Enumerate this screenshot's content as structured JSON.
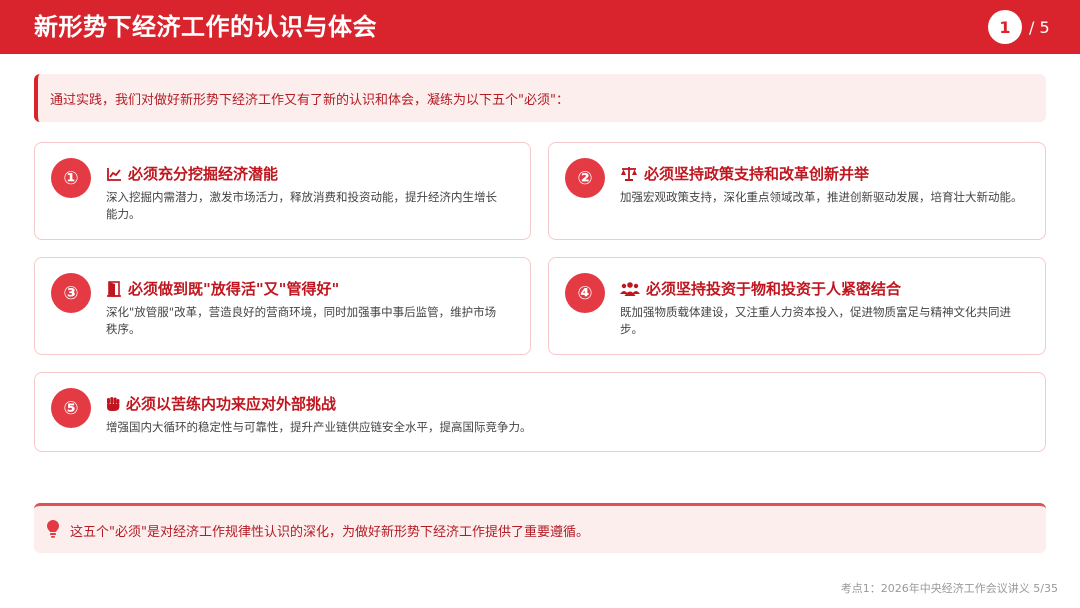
{
  "header": {
    "title": "新形势下经济工作的认识与体会",
    "page_current": "1",
    "page_total": "/ 5"
  },
  "intro": "通过实践，我们对做好新形势下经济工作又有了新的认识和体会，凝练为以下五个\"必须\"：",
  "cards": [
    {
      "num": "①",
      "icon": "line-chart-icon",
      "title": "必须充分挖掘经济潜能",
      "desc_line1": "深入挖掘内需潜力，激发市场活力，释放消费和投资动能，提升经济内生增长",
      "desc_line2": "能力。"
    },
    {
      "num": "②",
      "icon": "balance-scale-icon",
      "title": "必须坚持政策支持和改革创新并举",
      "desc_line1": "加强宏观政策支持，深化重点领域改革，推进创新驱动发展，培育壮大新动能。",
      "desc_line2": ""
    },
    {
      "num": "③",
      "icon": "door-open-icon",
      "title": "必须做到既\"放得活\"又\"管得好\"",
      "desc_line1": "深化\"放管服\"改革，营造良好的营商环境，同时加强事中事后监管，维护市场",
      "desc_line2": "秩序。"
    },
    {
      "num": "④",
      "icon": "people-group-icon",
      "title": "必须坚持投资于物和投资于人紧密结合",
      "desc_line1": "既加强物质载体建设，又注重人力资本投入，促进物质富足与精神文化共同进",
      "desc_line2": "步。"
    },
    {
      "num": "⑤",
      "icon": "fist-icon",
      "title": "必须以苦练内功来应对外部挑战",
      "desc_line1": "增强国内大循环的稳定性与可靠性，提升产业链供应链安全水平，提高国际竞争力。",
      "desc_line2": ""
    }
  ],
  "summary": {
    "icon": "lightbulb-icon",
    "text": "这五个\"必须\"是对经济工作规律性认识的深化，为做好新形势下经济工作提供了重要遵循。"
  },
  "footer": "考点1：2026年中央经济工作会议讲义   5/35",
  "colors": {
    "brand_red": "#d9232d",
    "circle_red": "#e33a44",
    "title_red": "#c0161f",
    "light_pink": "#fdeeee",
    "card_border": "#f6c9cc"
  }
}
